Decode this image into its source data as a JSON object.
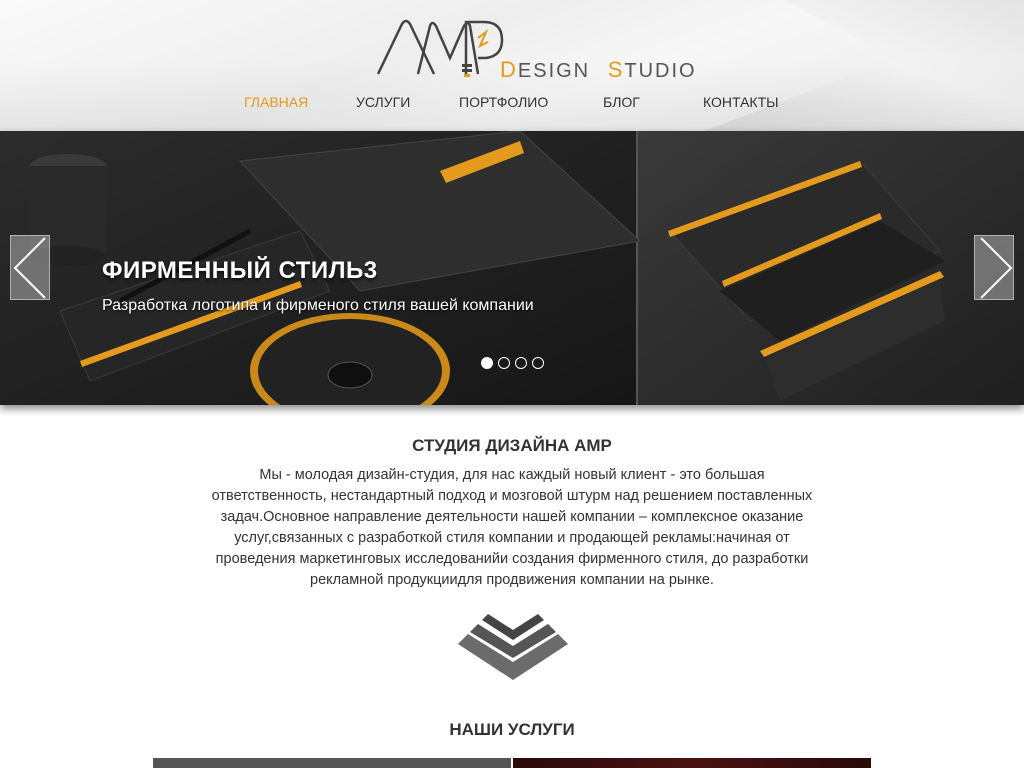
{
  "header": {
    "logo_text_mark": "AMP",
    "logo_tagline": {
      "d_letter": "D",
      "d_rest": "ESIGN",
      "s_letter": "S",
      "s_rest": "TUDIO"
    },
    "accent_color": "#e49a1c"
  },
  "nav": {
    "items": [
      {
        "label": "ГЛАВНАЯ",
        "active": true
      },
      {
        "label": "УСЛУГИ",
        "active": false
      },
      {
        "label": "ПОРТФОЛИО",
        "active": false
      },
      {
        "label": "БЛОГ",
        "active": false
      },
      {
        "label": "КОНТАКТЫ",
        "active": false
      }
    ]
  },
  "slider": {
    "title": "ФИРМЕННЫЙ СТИЛЬ3",
    "subtitle": "Разработка логотипа и фирменого стиля вашей компании",
    "slides_count": 4,
    "active_slide": 1,
    "prev_icon": "chevron-left-icon",
    "next_icon": "chevron-right-icon"
  },
  "about": {
    "title": "СТУДИЯ ДИЗАЙНА AMP",
    "text": "Мы - молодая дизайн-студия, для нас каждый новый клиент - это большая ответственность, нестандартный подход и мозговой штурм над решением поставленных задач.Основное направление деятельности нашей компании – комплексное оказание услуг,связанных с разработкой стиля компании и продающей рекламы:начиная от проведения маркетинговых исследованийи создания фирменного стиля, до разработки рекламной продукциидля продвижения компании на рынке."
  },
  "services": {
    "title": "НАШИ УСЛУГИ"
  }
}
